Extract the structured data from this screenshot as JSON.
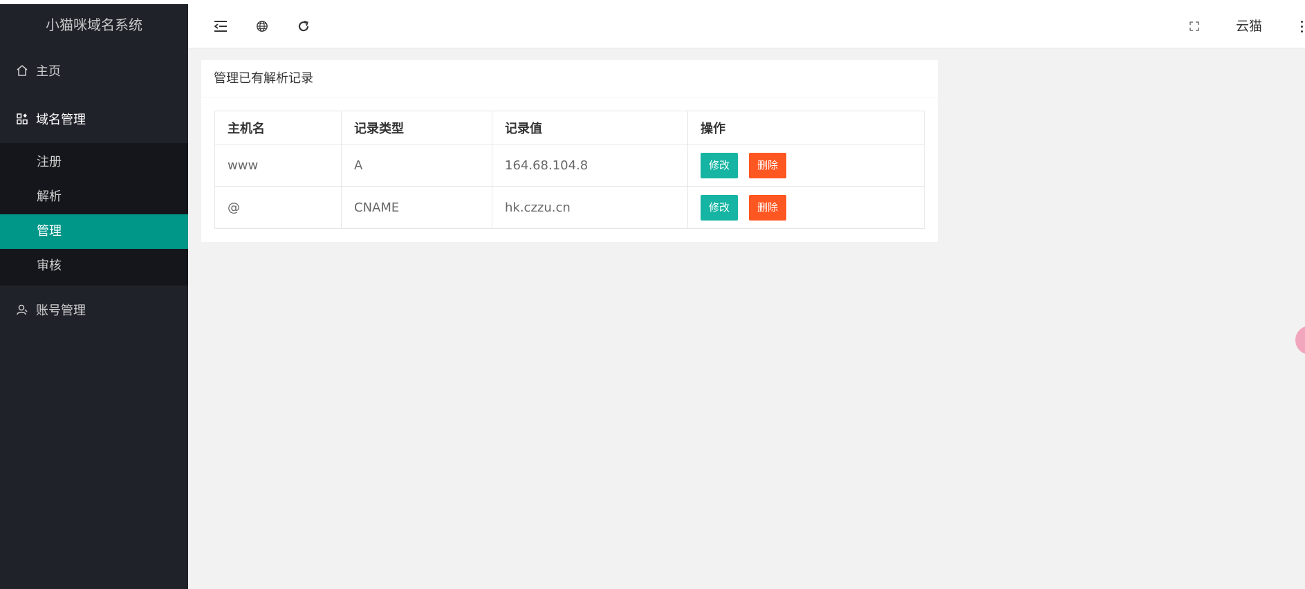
{
  "app": {
    "title": "小猫咪域名系统"
  },
  "sidebar": {
    "items": [
      {
        "label": "主页",
        "icon": "home-icon"
      },
      {
        "label": "域名管理",
        "icon": "grid-apps-icon"
      },
      {
        "label": "账号管理",
        "icon": "user-icon"
      }
    ],
    "subitems": [
      {
        "label": "注册"
      },
      {
        "label": "解析"
      },
      {
        "label": "管理"
      },
      {
        "label": "审核"
      }
    ]
  },
  "header": {
    "user": "云猫",
    "icons": [
      "indent-icon",
      "globe-icon",
      "refresh-icon",
      "fullscreen-icon",
      "more-vertical-icon"
    ]
  },
  "card": {
    "title": "管理已有解析记录",
    "table": {
      "headers": [
        "主机名",
        "记录类型",
        "记录值",
        "操作"
      ],
      "rows": [
        {
          "host": "www",
          "type": "A",
          "value": "164.68.104.8"
        },
        {
          "host": "@",
          "type": "CNAME",
          "value": "hk.czzu.cn"
        }
      ],
      "actions": {
        "edit": "修改",
        "delete": "删除"
      }
    }
  },
  "colors": {
    "sidebar_bg": "#20222a",
    "subnav_bg": "#15161b",
    "selected": "#009688",
    "edit_button": "#16b4a2",
    "delete_button": "#ff5722"
  }
}
